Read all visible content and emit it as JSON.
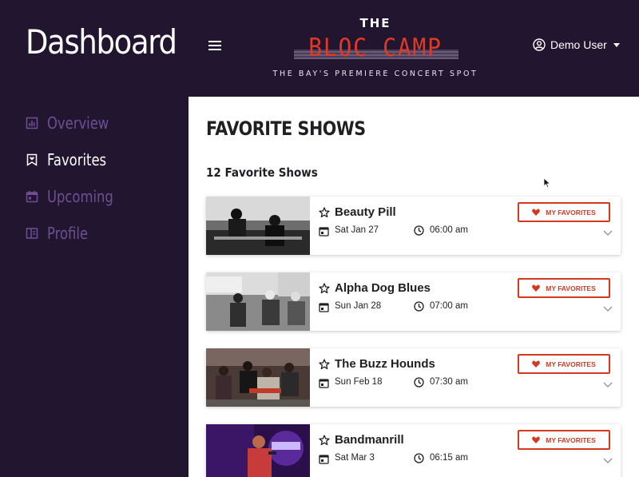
{
  "header": {
    "dashboard_title": "Dashboard",
    "logo": {
      "the": "THE",
      "name": "BLOC CAMP",
      "tagline": "THE BAY'S PREMIERE CONCERT SPOT"
    },
    "user": {
      "name": "Demo User"
    }
  },
  "sidebar": {
    "items": [
      {
        "label": "Overview",
        "icon": "bar-chart-icon",
        "active": false
      },
      {
        "label": "Favorites",
        "icon": "bookmark-heart-icon",
        "active": true
      },
      {
        "label": "Upcoming",
        "icon": "calendar-icon",
        "active": false
      },
      {
        "label": "Profile",
        "icon": "profile-card-icon",
        "active": false
      }
    ]
  },
  "main": {
    "page_title": "FAVORITE SHOWS",
    "count_label": "12 Favorite Shows",
    "shows": [
      {
        "name": "Beauty Pill",
        "date": "Sat Jan 27",
        "time": "06:00 am",
        "button": "MY FAVORITES"
      },
      {
        "name": "Alpha Dog Blues",
        "date": "Sun Jan 28",
        "time": "07:00 am",
        "button": "MY FAVORITES"
      },
      {
        "name": "The Buzz Hounds",
        "date": "Sun Feb 18",
        "time": "07:30 am",
        "button": "MY FAVORITES"
      },
      {
        "name": "Bandmanrill",
        "date": "Sat Mar 3",
        "time": "06:15 am",
        "button": "MY FAVORITES"
      }
    ]
  },
  "colors": {
    "background": "#221530",
    "accent_red": "#d4391f",
    "logo_red": "#e03a22",
    "nav_inactive": "#6e4f93",
    "text_dark": "#1f1f24"
  }
}
